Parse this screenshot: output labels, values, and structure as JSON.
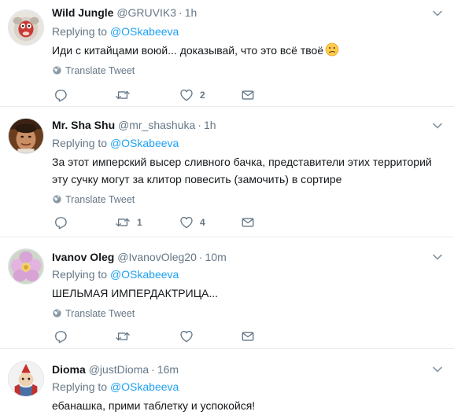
{
  "reply_label": "Replying to",
  "translate_label": "Translate Tweet",
  "tweets": [
    {
      "name": "Wild Jungle",
      "handle": "@GRUVIK3",
      "time": "1h",
      "replying_to": "@OSkabeeva",
      "text": "Иди с китайцами воюй... доказывай, что это всё твоё",
      "emoji": "confused-face-emoji",
      "replies": "",
      "retweets": "",
      "likes": "2"
    },
    {
      "name": "Mr. Sha Shu",
      "handle": "@mr_shashuka",
      "time": "1h",
      "replying_to": "@OSkabeeva",
      "text": "За этот имперский высер сливного бачка, представители этих территорий эту сучку могут за клитор повесить (замочить) в сортире",
      "replies": "",
      "retweets": "1",
      "likes": "4"
    },
    {
      "name": "Ivanov Oleg",
      "handle": "@IvanovOleg20",
      "time": "10m",
      "replying_to": "@OSkabeeva",
      "text": "ШЕЛЬМАЯ ИМПЕРДАКТРИЦА...",
      "replies": "",
      "retweets": "",
      "likes": ""
    },
    {
      "name": "Dioma",
      "handle": "@justDioma",
      "time": "16m",
      "replying_to": "@OSkabeeva",
      "text": "ебанашка, прими таблетку и успокойся!"
    }
  ],
  "colors": {
    "link": "#1da1f2",
    "secondary": "#657786",
    "primary_text": "#14171a",
    "divider": "#e6ecf0"
  }
}
